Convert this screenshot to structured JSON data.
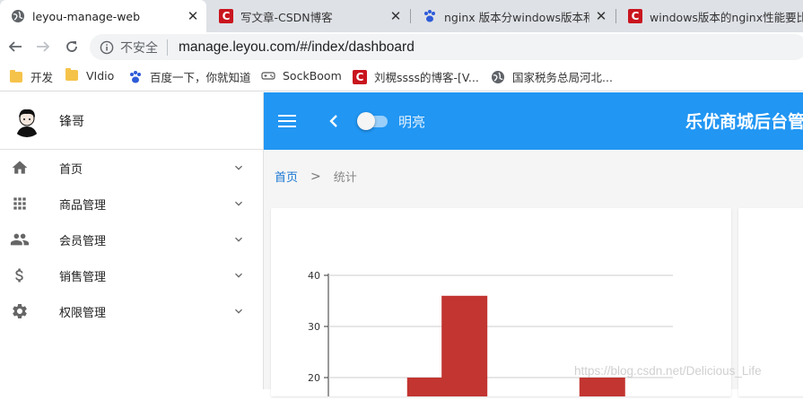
{
  "browser": {
    "tabs": [
      {
        "title": "leyou-manage-web",
        "icon": "globe-icon",
        "active": true
      },
      {
        "title": "写文章-CSDN博客",
        "icon": "csdn-icon",
        "active": false
      },
      {
        "title": "nginx 版本分windows版本和l",
        "icon": "baidu-paw-icon",
        "active": false
      },
      {
        "title": "windows版本的nginx性能要比",
        "icon": "csdn-icon",
        "active": false
      }
    ],
    "close_glyph": "✕",
    "security_label": "不安全",
    "url": "manage.leyou.com/#/index/dashboard",
    "bookmarks": [
      {
        "label": "开发",
        "icon": "folder-icon"
      },
      {
        "label": "VIdio",
        "icon": "folder-icon"
      },
      {
        "label": "百度一下，你就知道",
        "icon": "baidu-paw-icon"
      },
      {
        "label": "SockBoom",
        "icon": "gamepad-icon"
      },
      {
        "label": "刘榥ssss的博客-[V...",
        "icon": "csdn-icon"
      },
      {
        "label": "国家税务总局河北...",
        "icon": "globe-icon"
      }
    ]
  },
  "sidebar": {
    "user_name": "锋哥",
    "menu": [
      {
        "label": "首页",
        "icon": "home-icon"
      },
      {
        "label": "商品管理",
        "icon": "apps-grid-icon"
      },
      {
        "label": "会员管理",
        "icon": "people-icon"
      },
      {
        "label": "销售管理",
        "icon": "dollar-icon"
      },
      {
        "label": "权限管理",
        "icon": "gear-icon"
      }
    ]
  },
  "header": {
    "theme_label": "明亮",
    "title": "乐优商城后台管"
  },
  "breadcrumb": {
    "home": "首页",
    "separator": ">",
    "current": "统计"
  },
  "chart_data": {
    "type": "bar",
    "ylim": [
      18,
      40
    ],
    "ticks": [
      20,
      30,
      40
    ],
    "tick_labels": [
      "20",
      "30",
      "40"
    ],
    "grid": true,
    "bar_color": "#c23531",
    "bars": [
      {
        "value": 20
      },
      {
        "value": 36
      },
      {
        "value": 20
      }
    ],
    "title": "",
    "xlabel": "",
    "ylabel": ""
  },
  "watermark": "https://blog.csdn.net/Delicious_Life",
  "colors": {
    "primary": "#2196f3",
    "bar": "#c23531",
    "link": "#1976d2"
  }
}
